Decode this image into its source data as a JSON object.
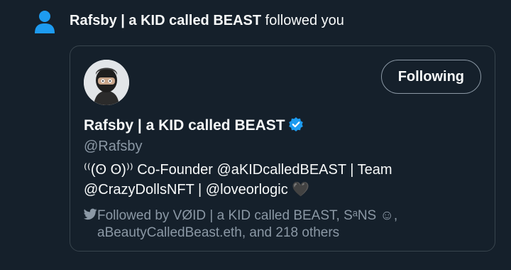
{
  "notification": {
    "icon": "person-icon",
    "name": "Rafsby | a KID called BEAST",
    "action": " followed you"
  },
  "card": {
    "display_name": "Rafsby | a KID called BEAST",
    "verified_icon": "verified-badge-icon",
    "handle": "@Rafsby",
    "follow_button_label": "Following",
    "bio_line1": "⁽⁽(ʘ ʘ)⁾⁾ Co-Founder @aKIDcalledBEAST | Team",
    "bio_line2": "@CrazyDollsNFT | @loveorlogic 🖤",
    "followed_by_line1": "Followed by VØID | a KID called BEAST, SᵃΝS ☺,",
    "followed_by_line2": "aBeautyCalledBeast.eth, and 218 others"
  },
  "colors": {
    "background": "#15202b",
    "accent": "#1d9bf0",
    "text": "#f7f9f9",
    "muted": "#8b98a5",
    "border": "#38444d"
  }
}
